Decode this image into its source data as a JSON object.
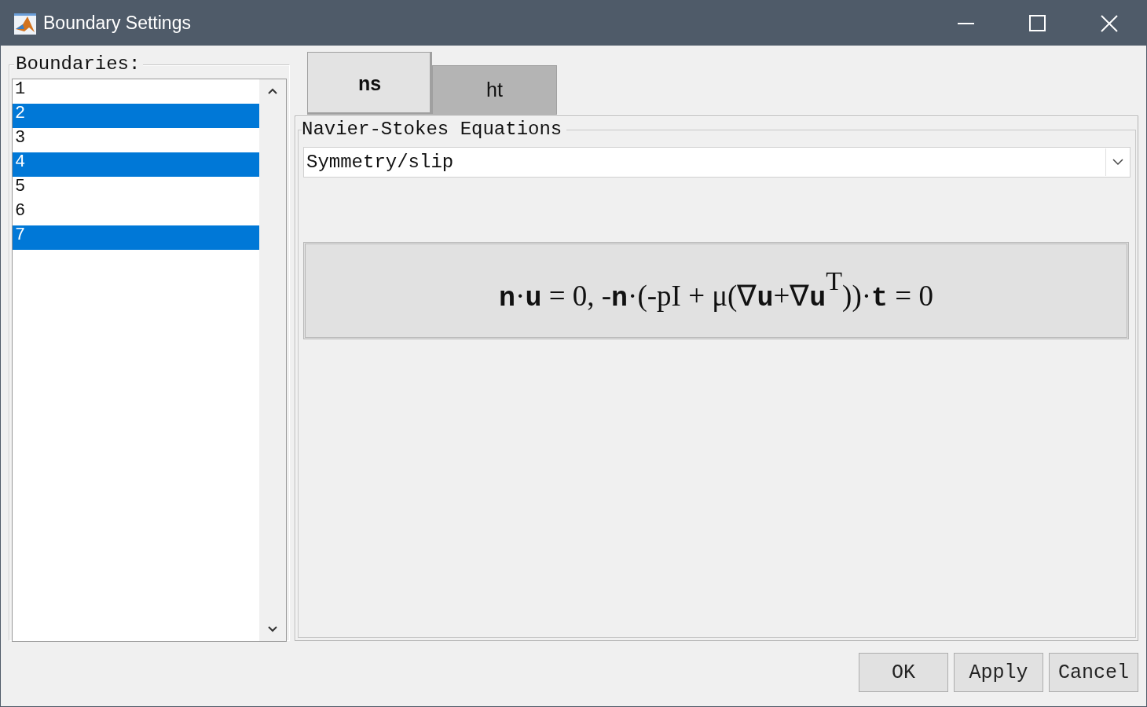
{
  "window": {
    "title": "Boundary Settings"
  },
  "boundaries": {
    "label": "Boundaries:",
    "items": [
      {
        "label": "1",
        "selected": false
      },
      {
        "label": "2",
        "selected": true
      },
      {
        "label": "3",
        "selected": false
      },
      {
        "label": "4",
        "selected": true
      },
      {
        "label": "5",
        "selected": false
      },
      {
        "label": "6",
        "selected": false
      },
      {
        "label": "7",
        "selected": true
      }
    ]
  },
  "tabs": [
    {
      "label": "ns",
      "selected": true
    },
    {
      "label": "ht",
      "selected": false
    }
  ],
  "group": {
    "title": "Navier-Stokes Equations",
    "condition": {
      "value": "Symmetry/slip"
    },
    "equation": "**n**·**u** = 0, -**n**·(-pI + μ(∇**u**+∇**u**$^{T}$))·**t** = 0"
  },
  "buttons": [
    "OK",
    "Apply",
    "Cancel"
  ]
}
